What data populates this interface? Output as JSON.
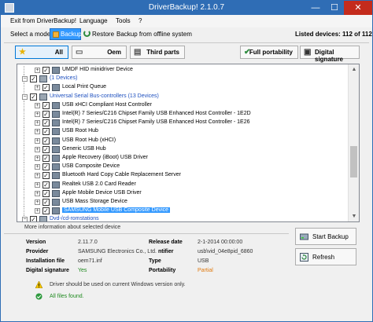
{
  "window": {
    "title": "DriverBackup! 2.1.0.7",
    "min": "—",
    "max": "☐",
    "close": "✕"
  },
  "menu": [
    "Exit from DriverBackup!",
    "Language",
    "Tools",
    "?"
  ],
  "modebar": {
    "label": "Select a mode",
    "backup": "Backup",
    "restore": "Restore",
    "offline": "Backup from offline system",
    "listed": "Listed devices: 112 of 112"
  },
  "filters": {
    "all": "All",
    "oem": "Oem",
    "third": "Third parts",
    "portability": "Full portability",
    "digital": "Digital signature"
  },
  "tree": [
    {
      "type": "device",
      "label": "UMDF HID minidriver Device"
    },
    {
      "type": "category",
      "label": "(1 Devices)"
    },
    {
      "type": "device",
      "label": "Local Print Queue"
    },
    {
      "type": "category",
      "label": "Universal Serial Bus-controllers   (13 Devices)"
    },
    {
      "type": "device",
      "label": "USB xHCI Compliant Host Controller"
    },
    {
      "type": "device",
      "label": "Intel(R) 7 Series/C216 Chipset Family USB Enhanced Host Controller - 1E2D"
    },
    {
      "type": "device",
      "label": "Intel(R) 7 Series/C216 Chipset Family USB Enhanced Host Controller - 1E26"
    },
    {
      "type": "device",
      "label": "USB Root Hub"
    },
    {
      "type": "device",
      "label": "USB Root Hub (xHCI)"
    },
    {
      "type": "device",
      "label": "Generic USB Hub"
    },
    {
      "type": "device",
      "label": "Apple Recovery (iBoot) USB Driver"
    },
    {
      "type": "device",
      "label": "USB Composite Device"
    },
    {
      "type": "device",
      "label": "Bluetooth Hard Copy Cable Replacement Server"
    },
    {
      "type": "device",
      "label": "Realtek USB 2.0 Card Reader"
    },
    {
      "type": "device",
      "label": "Apple Mobile Device USB Driver"
    },
    {
      "type": "device",
      "label": "USB Mass Storage Device"
    },
    {
      "type": "device",
      "label": "SAMSUNG Mobile USB Composite Device",
      "selected": true
    },
    {
      "type": "category",
      "label": "Dvd-/cd-romstations"
    }
  ],
  "info": {
    "heading": "More information about selected device",
    "version_k": "Version",
    "version_v": "2.11.7.0",
    "provider_k": "Provider",
    "provider_v": "SAMSUNG Electronics Co., Ltd.",
    "install_k": "Installation file",
    "install_v": "oem71.inf",
    "digsig_k": "Digital signature",
    "digsig_v": "Yes",
    "release_k": "Release date",
    "release_v": "2-1-2014 00:00:00",
    "ident_k": "ntifier",
    "ident_v": "usb\\vid_04e8pid_6860",
    "type_k": "Type",
    "type_v": "USB",
    "port_k": "Portability",
    "port_v": "Partial",
    "note1": "Driver should be used on current Windows version only.",
    "note2": "All files found."
  },
  "actions": {
    "start": "Start Backup",
    "refresh": "Refresh"
  }
}
